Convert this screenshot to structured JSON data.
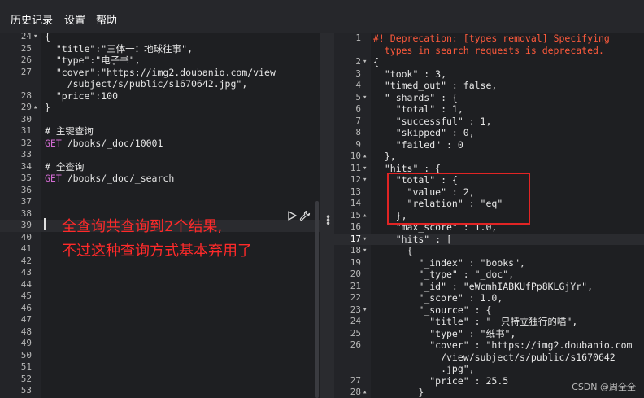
{
  "menu": {
    "items": [
      "历史记录",
      "设置",
      "帮助"
    ]
  },
  "editor": {
    "lines": [
      {
        "num": "24",
        "fold": "▾",
        "segs": [
          {
            "t": "{",
            "c": "#e6e6e6"
          }
        ]
      },
      {
        "num": "25",
        "segs": [
          {
            "t": "  \"title\":\"三体一：地球往事\",",
            "c": "#e6e6e6"
          }
        ]
      },
      {
        "num": "26",
        "segs": [
          {
            "t": "  \"type\":\"电子书\",",
            "c": "#e6e6e6"
          }
        ]
      },
      {
        "num": "27",
        "segs": [
          {
            "t": "  \"cover\":\"https://img2.doubanio.com/view",
            "c": "#e6e6e6"
          }
        ]
      },
      {
        "num": "",
        "segs": [
          {
            "t": "    /subject/s/public/s1670642.jpg\",",
            "c": "#e6e6e6"
          }
        ]
      },
      {
        "num": "28",
        "segs": [
          {
            "t": "  \"price\":100",
            "c": "#e6e6e6"
          }
        ]
      },
      {
        "num": "29",
        "fold": "▴",
        "segs": [
          {
            "t": "}",
            "c": "#e6e6e6"
          }
        ]
      },
      {
        "num": "30",
        "segs": []
      },
      {
        "num": "31",
        "segs": [
          {
            "t": "# 主键查询",
            "c": "#e6e6e6"
          }
        ]
      },
      {
        "num": "32",
        "segs": [
          {
            "t": "GET",
            "c": "#d16bd1"
          },
          {
            "t": " /books/_doc/10001",
            "c": "#e6e6e6"
          }
        ]
      },
      {
        "num": "33",
        "segs": []
      },
      {
        "num": "34",
        "segs": [
          {
            "t": "# 全查询",
            "c": "#e6e6e6"
          }
        ]
      },
      {
        "num": "35",
        "segs": [
          {
            "t": "GET",
            "c": "#d16bd1"
          },
          {
            "t": " /books/_doc/_search",
            "c": "#e6e6e6"
          }
        ]
      },
      {
        "num": "36",
        "segs": []
      },
      {
        "num": "37",
        "segs": []
      },
      {
        "num": "38",
        "segs": []
      },
      {
        "num": "39",
        "segs": [],
        "active": true
      },
      {
        "num": "40",
        "segs": []
      },
      {
        "num": "41",
        "segs": []
      },
      {
        "num": "42",
        "segs": []
      },
      {
        "num": "43",
        "segs": []
      },
      {
        "num": "44",
        "segs": []
      },
      {
        "num": "45",
        "segs": []
      },
      {
        "num": "46",
        "segs": []
      },
      {
        "num": "47",
        "segs": []
      },
      {
        "num": "48",
        "segs": []
      },
      {
        "num": "49",
        "segs": []
      },
      {
        "num": "50",
        "segs": []
      },
      {
        "num": "51",
        "segs": []
      },
      {
        "num": "52",
        "segs": []
      },
      {
        "num": "53",
        "segs": []
      }
    ]
  },
  "response": {
    "lines": [
      {
        "num": "1",
        "segs": [
          {
            "t": "#! Deprecation: [types removal] Specifying",
            "c": "#ff5a3c"
          }
        ]
      },
      {
        "num": "",
        "segs": [
          {
            "t": "  types in search requests is deprecated.",
            "c": "#ff5a3c"
          }
        ]
      },
      {
        "num": "2",
        "fold": "▾",
        "segs": [
          {
            "t": "{",
            "c": "#e6e6e6"
          }
        ]
      },
      {
        "num": "3",
        "segs": [
          {
            "t": "  \"took\" : 3,",
            "c": "#e6e6e6"
          }
        ]
      },
      {
        "num": "4",
        "segs": [
          {
            "t": "  \"timed_out\" : false,",
            "c": "#e6e6e6"
          }
        ]
      },
      {
        "num": "5",
        "fold": "▾",
        "segs": [
          {
            "t": "  \"_shards\" : {",
            "c": "#e6e6e6"
          }
        ]
      },
      {
        "num": "6",
        "segs": [
          {
            "t": "    \"total\" : 1,",
            "c": "#e6e6e6"
          }
        ]
      },
      {
        "num": "7",
        "segs": [
          {
            "t": "    \"successful\" : 1,",
            "c": "#e6e6e6"
          }
        ]
      },
      {
        "num": "8",
        "segs": [
          {
            "t": "    \"skipped\" : 0,",
            "c": "#e6e6e6"
          }
        ]
      },
      {
        "num": "9",
        "segs": [
          {
            "t": "    \"failed\" : 0",
            "c": "#e6e6e6"
          }
        ]
      },
      {
        "num": "10",
        "fold": "▴",
        "segs": [
          {
            "t": "  },",
            "c": "#e6e6e6"
          }
        ]
      },
      {
        "num": "11",
        "fold": "▾",
        "segs": [
          {
            "t": "  \"hits\" : {",
            "c": "#e6e6e6"
          }
        ]
      },
      {
        "num": "12",
        "fold": "▾",
        "segs": [
          {
            "t": "    \"total\" : {",
            "c": "#e6e6e6"
          }
        ]
      },
      {
        "num": "13",
        "segs": [
          {
            "t": "      \"value\" : 2,",
            "c": "#e6e6e6"
          }
        ]
      },
      {
        "num": "14",
        "segs": [
          {
            "t": "      \"relation\" : \"eq\"",
            "c": "#e6e6e6"
          }
        ]
      },
      {
        "num": "15",
        "fold": "▴",
        "segs": [
          {
            "t": "    },",
            "c": "#e6e6e6"
          }
        ]
      },
      {
        "num": "16",
        "segs": [
          {
            "t": "    \"max_score\" : 1.0,",
            "c": "#e6e6e6"
          }
        ]
      },
      {
        "num": "17",
        "fold": "▾",
        "segs": [
          {
            "t": "    \"hits\" : [",
            "c": "#e6e6e6"
          }
        ],
        "active": true
      },
      {
        "num": "18",
        "fold": "▾",
        "segs": [
          {
            "t": "      {",
            "c": "#e6e6e6"
          }
        ]
      },
      {
        "num": "19",
        "segs": [
          {
            "t": "        \"_index\" : \"books\",",
            "c": "#e6e6e6"
          }
        ]
      },
      {
        "num": "20",
        "segs": [
          {
            "t": "        \"_type\" : \"_doc\",",
            "c": "#e6e6e6"
          }
        ]
      },
      {
        "num": "21",
        "segs": [
          {
            "t": "        \"_id\" : \"eWcmhIABKUfPp8KLGjYr\",",
            "c": "#e6e6e6"
          }
        ]
      },
      {
        "num": "22",
        "segs": [
          {
            "t": "        \"_score\" : 1.0,",
            "c": "#e6e6e6"
          }
        ]
      },
      {
        "num": "23",
        "fold": "▾",
        "segs": [
          {
            "t": "        \"_source\" : {",
            "c": "#e6e6e6"
          }
        ]
      },
      {
        "num": "24",
        "segs": [
          {
            "t": "          \"title\" : \"一只特立独行的喵\",",
            "c": "#e6e6e6"
          }
        ]
      },
      {
        "num": "25",
        "segs": [
          {
            "t": "          \"type\" : \"纸书\",",
            "c": "#e6e6e6"
          }
        ]
      },
      {
        "num": "26",
        "segs": [
          {
            "t": "          \"cover\" : \"https://img2.doubanio.com",
            "c": "#e6e6e6"
          }
        ]
      },
      {
        "num": "",
        "segs": [
          {
            "t": "            /view/subject/s/public/s1670642",
            "c": "#e6e6e6"
          }
        ]
      },
      {
        "num": "",
        "segs": [
          {
            "t": "            .jpg\",",
            "c": "#e6e6e6"
          }
        ]
      },
      {
        "num": "27",
        "segs": [
          {
            "t": "          \"price\" : 25.5",
            "c": "#e6e6e6"
          }
        ]
      },
      {
        "num": "28",
        "fold": "▴",
        "segs": [
          {
            "t": "        }",
            "c": "#e6e6e6"
          }
        ]
      }
    ]
  },
  "annotation": {
    "line1": "全查询共查询到2个结果,",
    "line2": "不过这种查询方式基本弃用了",
    "color": "#ff2a2a"
  },
  "watermark": "CSDN @周全全",
  "icons": {
    "run": "play-icon",
    "settings": "wrench-icon",
    "divider": "resize-handle-icon"
  },
  "colors": {
    "keyword": "#d16bd1",
    "warning": "#ff5a3c",
    "text": "#e6e6e6",
    "background": "#1e1f22"
  }
}
